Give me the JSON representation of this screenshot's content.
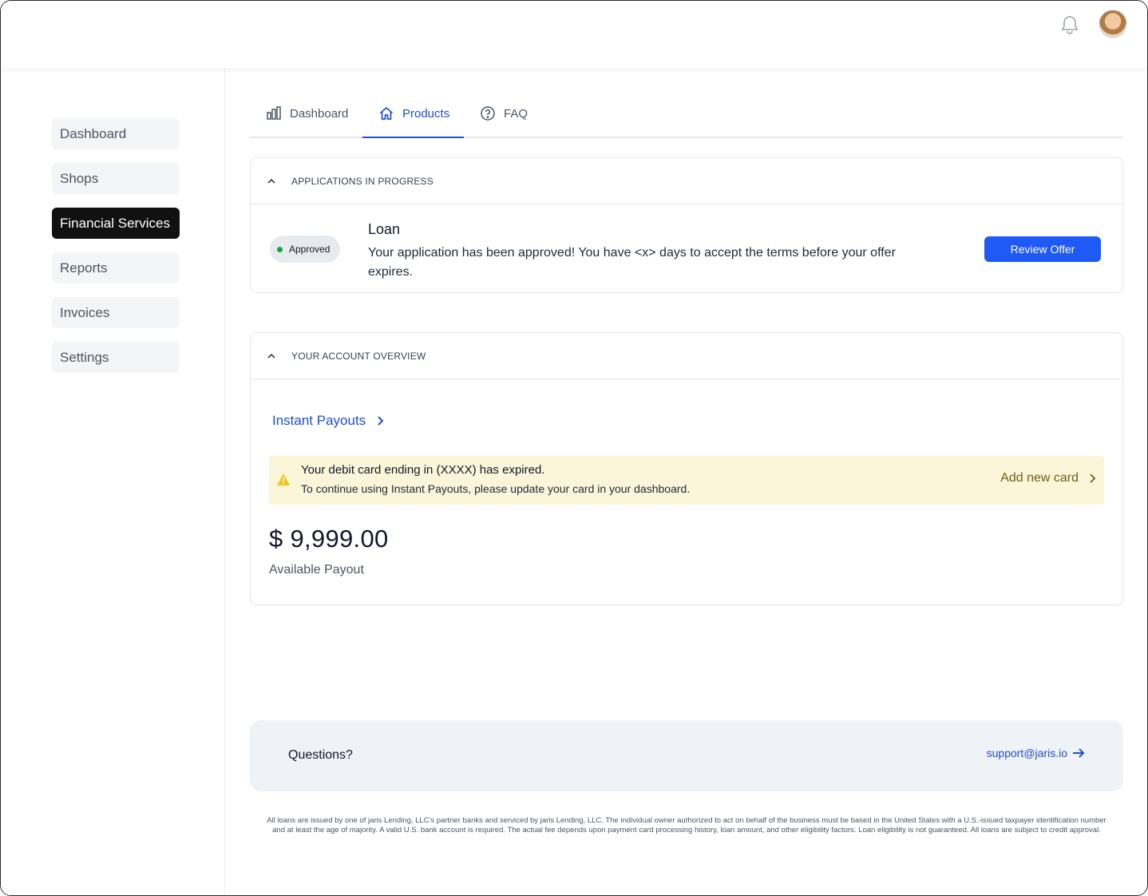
{
  "header": {
    "notifications_icon": "bell-icon",
    "avatar_icon": "user-avatar"
  },
  "sidebar": {
    "items": [
      {
        "label": "Dashboard",
        "active": false
      },
      {
        "label": "Shops",
        "active": false
      },
      {
        "label": "Financial Services",
        "active": true
      },
      {
        "label": "Reports",
        "active": false
      },
      {
        "label": "Invoices",
        "active": false
      },
      {
        "label": "Settings",
        "active": false
      }
    ]
  },
  "tabs": [
    {
      "label": "Dashboard",
      "icon": "bar-chart-icon",
      "active": false
    },
    {
      "label": "Products",
      "icon": "home-icon",
      "active": true
    },
    {
      "label": "FAQ",
      "icon": "question-circle-icon",
      "active": false
    }
  ],
  "applications": {
    "title": "APPLICATIONS IN PROGRESS",
    "status": "Approved",
    "product": "Loan",
    "message": "Your application has been approved! You have <x> days to accept the terms before your offer expires.",
    "button": "Review Offer"
  },
  "overview": {
    "title": "YOUR ACCOUNT OVERVIEW",
    "link": "Instant Payouts",
    "warning": {
      "title": "Your debit card ending in (XXXX) has expired.",
      "text": "To continue using Instant Payouts, please update your card in your dashboard.",
      "action": "Add new card"
    },
    "amount": "$ 9,999.00",
    "amount_label": "Available Payout"
  },
  "footer": {
    "questions": "Questions?",
    "email": "support@jaris.io",
    "disclaimer": "All loans are issued by one of jaris Lending, LLC's partner banks and serviced by jaris Lending, LLC. The individual owner authorized to act on behalf of the business must be based in the United States with a U.S.-issued taxpayer identification number and at least the age of majority. A valid U.S. bank account is required. The actual fee depends upon payment card processing history, loan amount, and other eligibility factors. Loan eligibility is not guaranteed. All loans are subject to credit approval."
  },
  "colors": {
    "accent": "#1d4ed8",
    "button": "#1f5af6",
    "approved": "#16a34a",
    "warning_bg": "#fbf6d9"
  }
}
